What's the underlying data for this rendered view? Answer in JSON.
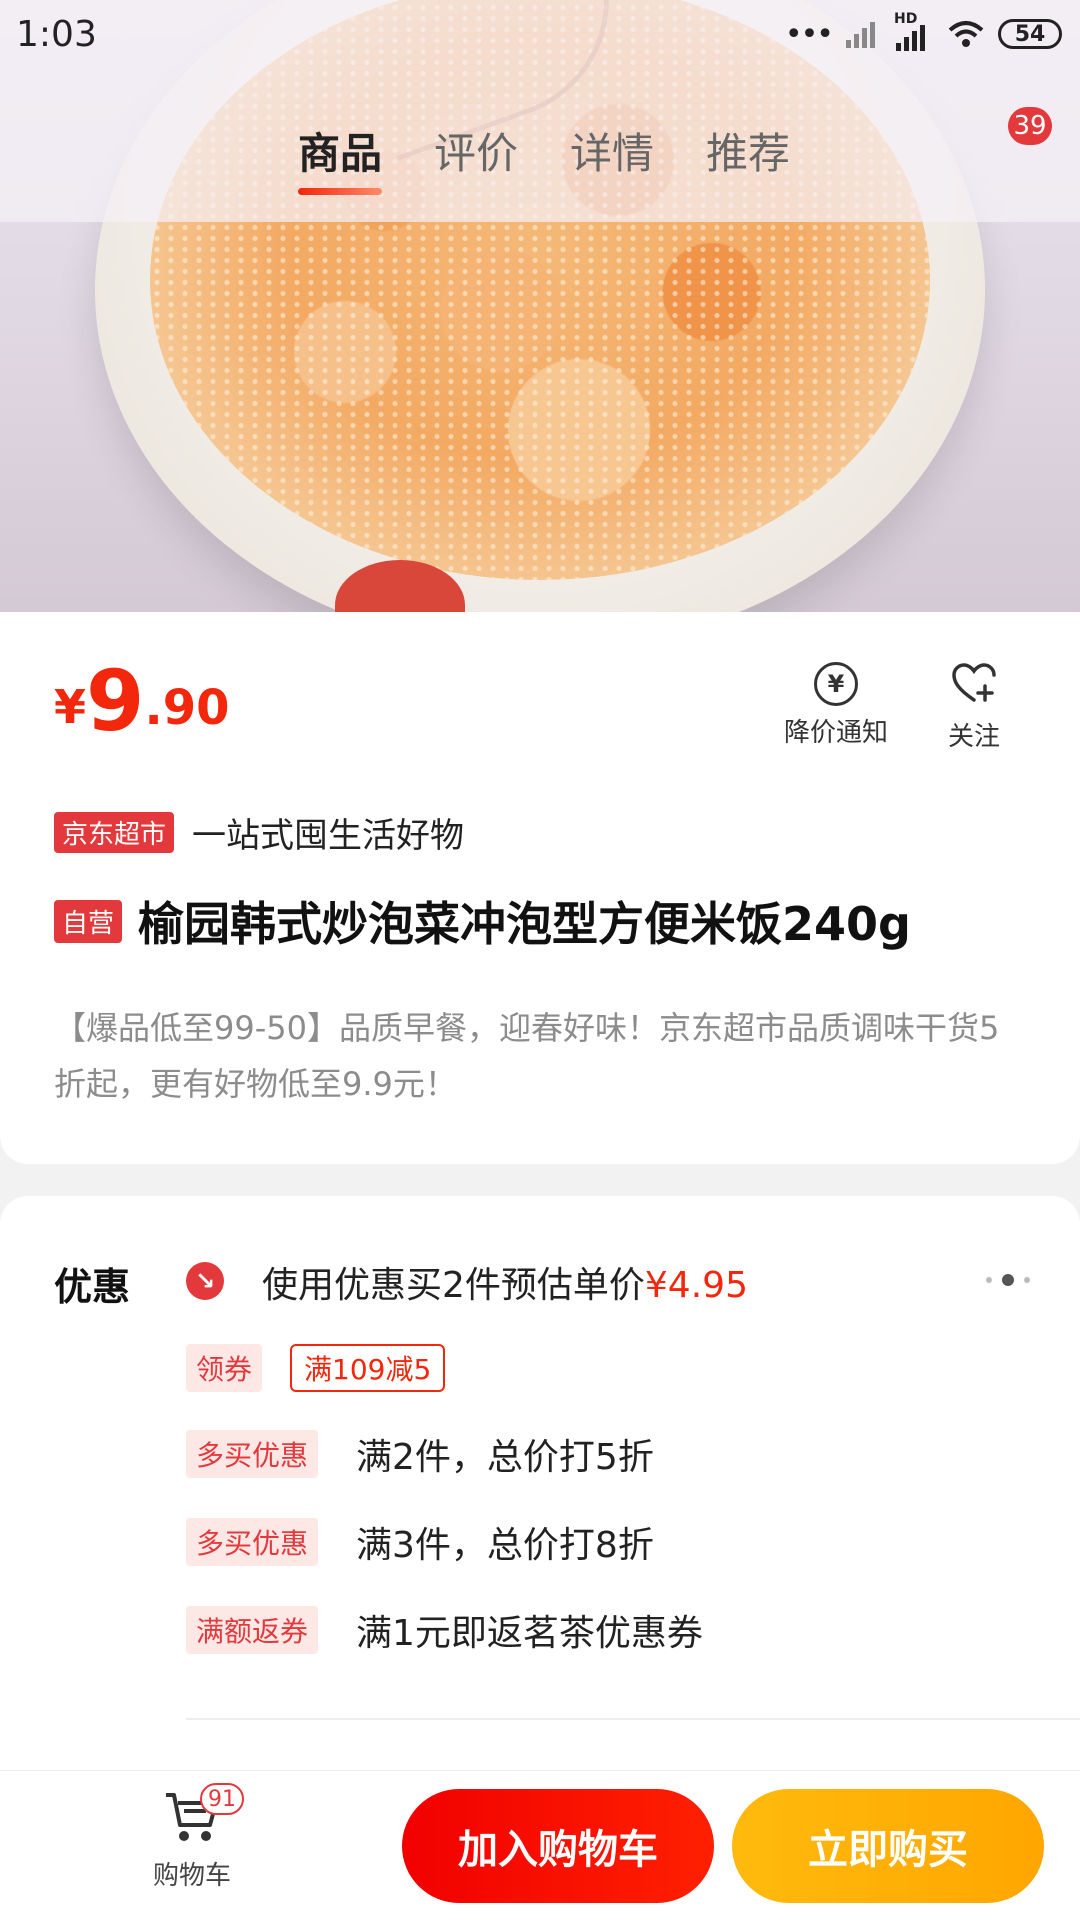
{
  "status_bar": {
    "time": "1:03",
    "hd_label": "HD",
    "battery": "54"
  },
  "top_tabs": [
    {
      "label": "商品",
      "active": true
    },
    {
      "label": "评价",
      "active": false
    },
    {
      "label": "详情",
      "active": false
    },
    {
      "label": "推荐",
      "active": false
    }
  ],
  "message_badge": "39",
  "price": {
    "currency": "¥",
    "integer": "9",
    "decimal": ".90"
  },
  "actions": {
    "price_alert": "降价通知",
    "follow": "关注"
  },
  "store": {
    "tag": "京东超市",
    "slogan": "一站式囤生活好物"
  },
  "product": {
    "self_tag": "自营",
    "title": "榆园韩式炒泡菜冲泡型方便米饭240g",
    "promo_desc": "【爆品低至99-50】品质早餐，迎春好味！京东超市品质调味干货5折起，更有好物低至9.9元！"
  },
  "discount": {
    "label": "优惠",
    "main_text": "使用优惠买2件预估单价",
    "main_price": "¥4.95",
    "coupon_pill": "领券",
    "coupon": "满109减5",
    "offers": [
      {
        "tag": "多买优惠",
        "text": "满2件，总价打5折"
      },
      {
        "tag": "多买优惠",
        "text": "满3件，总价打8折"
      },
      {
        "tag": "满额返券",
        "text": "满1元即返茗茶优惠券"
      }
    ]
  },
  "bottom_bar": {
    "cart_label": "购物车",
    "cart_count": "91",
    "add_to_cart": "加入购物车",
    "buy_now": "立即购买"
  },
  "colors": {
    "accent_red": "#f2270c",
    "buy_orange": "#ffb20a"
  }
}
